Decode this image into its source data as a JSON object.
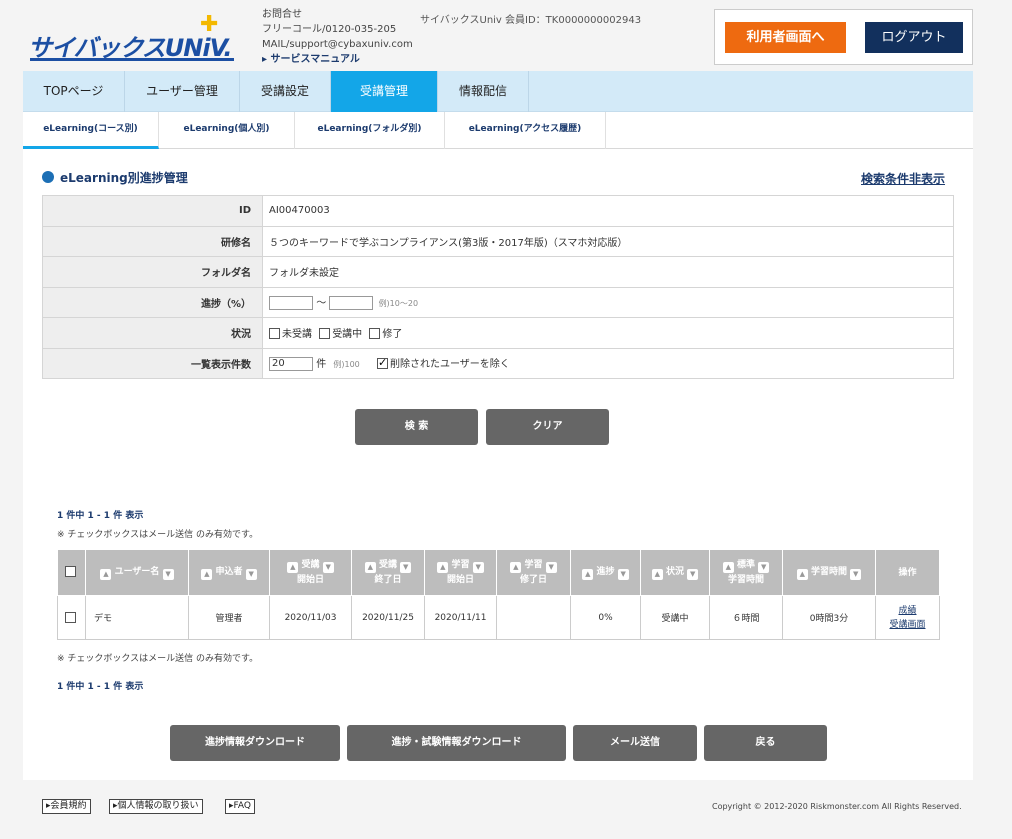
{
  "header": {
    "logo_text": "サイバックスUNiV.",
    "contact_title": "お問合せ",
    "freecall": "フリーコール/0120-035-205",
    "mail": "MAIL/support@cybaxuniv.com",
    "manual_link": "サービスマニュアル",
    "member_id": "サイバックスUniv 会員ID：TK0000000002943",
    "user_screen_button": "利用者画面へ",
    "logout_button": "ログアウト"
  },
  "main_nav": [
    "TOPページ",
    "ユーザー管理",
    "受講設定",
    "受講管理",
    "情報配信"
  ],
  "sub_nav": [
    "eLearning(コース別)",
    "eLearning(個人別)",
    "eLearning(フォルダ別)",
    "eLearning(アクセス履歴)"
  ],
  "section": {
    "title": "eLearning別進捗管理",
    "toggle_link": "検索条件非表示"
  },
  "form": {
    "id_label": "ID",
    "id_value": "AI00470003",
    "course_label": "研修名",
    "course_value": "５つのキーワードで学ぶコンプライアンス(第3版・2017年版)（スマホ対応版）",
    "folder_label": "フォルダ名",
    "folder_value": "フォルダ未設定",
    "progress_label": "進捗（%）",
    "progress_sep": "〜",
    "progress_example": "例)10〜20",
    "status_label": "状況",
    "status_options": [
      "未受講",
      "受講中",
      "修了"
    ],
    "count_label": "一覧表示件数",
    "count_value": "20",
    "count_unit": "件",
    "count_example": "例)100",
    "exclude_deleted": "削除されたユーザーを除く"
  },
  "buttons": {
    "search": "検 索",
    "clear": "クリア",
    "progress_download": "進捗情報ダウンロード",
    "exam_download": "進捗・試験情報ダウンロード",
    "send_mail": "メール送信",
    "back": "戻る"
  },
  "results": {
    "count_text": "1 件中 1 - 1 件 表示",
    "checkbox_note": "※ チェックボックスはメール送信 のみ有効です。",
    "headers": [
      "ユーザー名",
      "申込者",
      "受講\n開始日",
      "受講\n終了日",
      "学習\n開始日",
      "学習\n修了日",
      "進捗",
      "状況",
      "標準\n学習時間",
      "学習時間",
      "操作"
    ],
    "rows": [
      {
        "user": "デモ",
        "applicant": "管理者",
        "course_start": "2020/11/03",
        "course_end": "2020/11/25",
        "study_start": "2020/11/11",
        "study_end": "",
        "progress": "0%",
        "status": "受講中",
        "standard_time": "６時間",
        "study_time": "0時間3分",
        "action_grade": "成績",
        "action_view": "受講画面"
      }
    ]
  },
  "footer": {
    "links": [
      "会員規約",
      "個人情報の取り扱い",
      "FAQ"
    ],
    "copyright": "Copyright © 2012-2020 Riskmonster.com All Rights Reserved."
  },
  "colors": {
    "accent_blue": "#13a6e8",
    "navy": "#12305d",
    "orange": "#ee6a10",
    "nav_bg": "#d3eaf8"
  }
}
